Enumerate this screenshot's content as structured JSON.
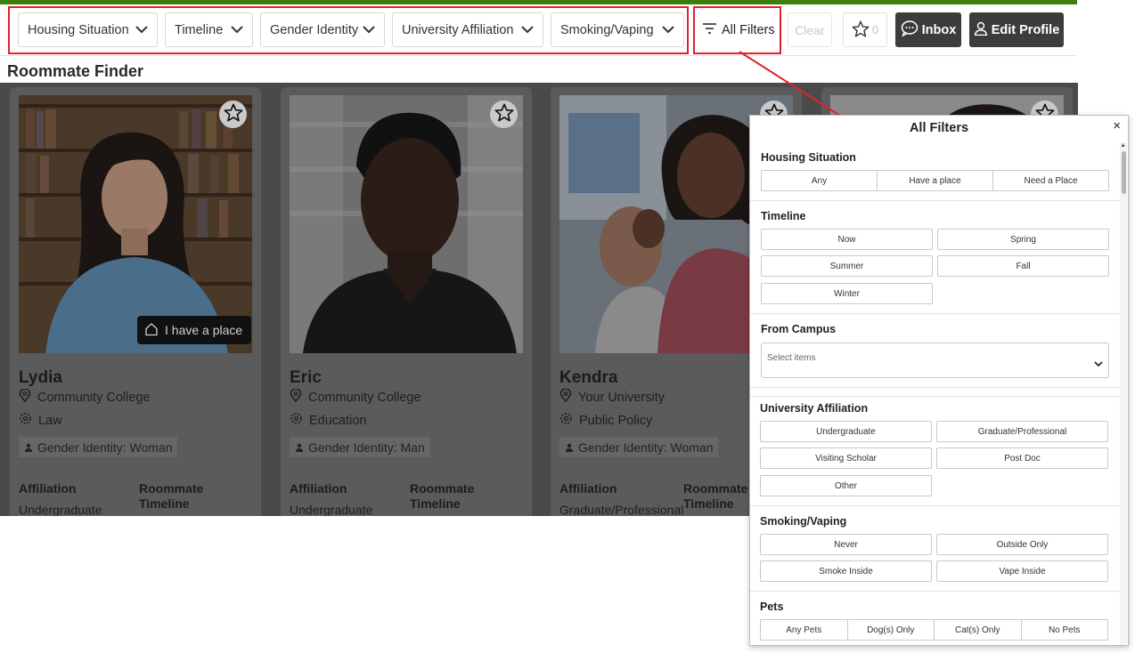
{
  "topbar": {
    "filters": [
      {
        "label": "Housing Situation"
      },
      {
        "label": "Timeline"
      },
      {
        "label": "Gender Identity"
      },
      {
        "label": "University Affiliation"
      },
      {
        "label": "Smoking/Vaping"
      }
    ],
    "all_filters_label": "All Filters",
    "clear_label": "Clear",
    "favorites_count": "0",
    "inbox_label": "Inbox",
    "edit_profile_label": "Edit Profile"
  },
  "page_title": "Roommate Finder",
  "cards": [
    {
      "name": "Lydia",
      "school": "Community College",
      "major": "Law",
      "gender": "Gender Identity: Woman",
      "affiliation_label": "Affiliation",
      "affiliation": "Undergraduate",
      "timeline_label": "Roommate Timeline",
      "badge": "I have a place"
    },
    {
      "name": "Eric",
      "school": "Community College",
      "major": "Education",
      "gender": "Gender Identity: Man",
      "affiliation_label": "Affiliation",
      "affiliation": "Undergraduate",
      "timeline_label": "Roommate Timeline"
    },
    {
      "name": "Kendra",
      "school": "Your University",
      "major": "Public Policy",
      "gender": "Gender Identity: Woman",
      "affiliation_label": "Affiliation",
      "affiliation": "Graduate/Professional",
      "timeline_label": "Roommate Timeline"
    }
  ],
  "panel": {
    "title": "All Filters",
    "close": "×",
    "housing": {
      "title": "Housing Situation",
      "options": [
        "Any",
        "Have a place",
        "Need a Place"
      ]
    },
    "timeline": {
      "title": "Timeline",
      "options": [
        "Now",
        "Spring",
        "Summer",
        "Fall",
        "Winter"
      ]
    },
    "from_campus": {
      "title": "From Campus",
      "placeholder": "Select items"
    },
    "affiliation": {
      "title": "University Affiliation",
      "options": [
        "Undergraduate",
        "Graduate/Professional",
        "Visiting Scholar",
        "Post Doc",
        "Other"
      ]
    },
    "smoking": {
      "title": "Smoking/Vaping",
      "options": [
        "Never",
        "Outside Only",
        "Smoke Inside",
        "Vape Inside"
      ]
    },
    "pets": {
      "title": "Pets",
      "options": [
        "Any Pets",
        "Dog(s) Only",
        "Cat(s) Only",
        "No Pets"
      ]
    }
  },
  "colors": {
    "brand_green": "#3d7e0f",
    "highlight_red": "#e2212c",
    "dark_button": "#3c3c3c"
  }
}
